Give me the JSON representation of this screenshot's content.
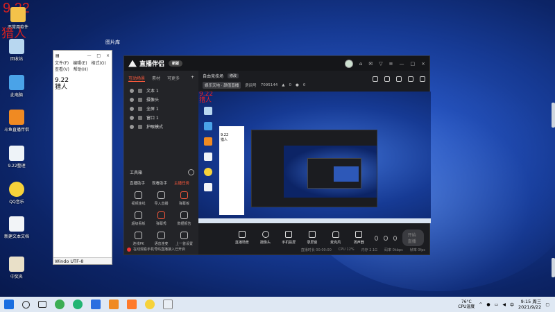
{
  "overlay": {
    "date": "9.22",
    "name": "猎人"
  },
  "desktop_icons": [
    {
      "label": "不常用软件"
    },
    {
      "label": "回收站"
    },
    {
      "label": "此电脑"
    },
    {
      "label": "斗鱼直播伴侣"
    },
    {
      "label": "9.22整理"
    },
    {
      "label": "QQ音乐"
    },
    {
      "label": "新建文本文档"
    },
    {
      "label": "中奖名"
    }
  ],
  "desktop_small_label": "图片库",
  "notepad": {
    "menu": [
      "文件(F)",
      "编辑(E)",
      "格式(O)",
      "查看(V)",
      "帮助(H)"
    ],
    "text": "9.22\n猎人",
    "status": "Windo  UTF-8"
  },
  "app": {
    "title": "直播伴侣",
    "version": "新版",
    "left_tabs": [
      "互动场景",
      "素材",
      "可更多"
    ],
    "sources": [
      "文本 1",
      "摄像头",
      "全屏 1",
      "窗口 1",
      "护眼模式"
    ],
    "tools_title": "工具箱",
    "tools_tabs": [
      "直播助手",
      "观看助手",
      "主播任务"
    ],
    "tools": [
      "视频连线",
      "导入直播",
      "弹幕板",
      "超级看板",
      "弹幕秀",
      "数据报告",
      "连线PK",
      "语音连麦",
      "上一首设置"
    ],
    "bottom_tip": "在线观看手机号码直播接入已开启",
    "room_title": "自由竞技场",
    "room_tag": "修改",
    "room_category": "娱乐天地 · 颜值直播",
    "room_id_label": "房间号",
    "room_id": "7095144",
    "likes": "0",
    "fans": "0",
    "controls": [
      "直播场景",
      "摄像头",
      "手机投屏",
      "录屏窗",
      "麦克风",
      "扬声器"
    ],
    "start_button": "开始直播",
    "status": [
      "直播时长 00:00:00",
      "CPU 12%",
      "内存 2.1G",
      "码率 0kbps",
      "帧率 0fps"
    ]
  },
  "taskbar": {
    "weather_temp": "76°C",
    "weather_label": "CPU温度",
    "time": "9:15 周三",
    "date": "2021/9/22"
  }
}
